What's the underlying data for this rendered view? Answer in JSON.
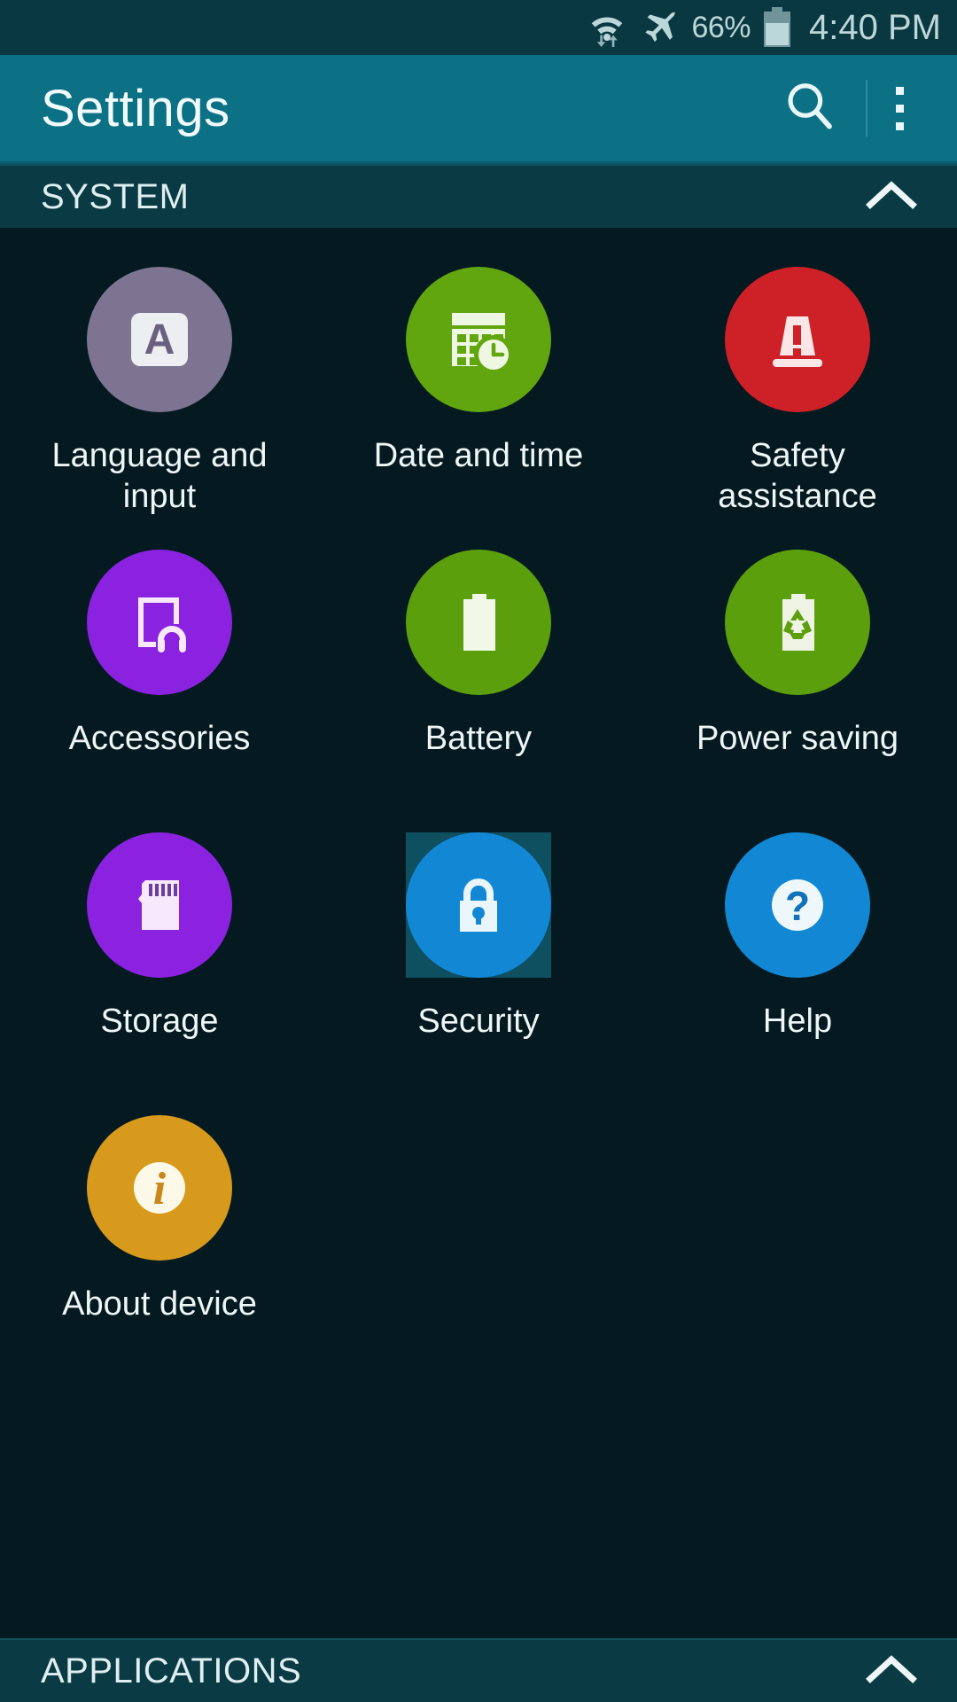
{
  "status_bar": {
    "wifi_icon": "wifi-data-transfer-icon",
    "airplane_icon": "airplane-mode-icon",
    "battery_percent": "66%",
    "battery_icon": "battery-icon",
    "time": "4:40 PM",
    "background_color": "#0a3840",
    "text_color": "#bcd7da"
  },
  "action_bar": {
    "title": "Settings",
    "search_icon": "search-icon",
    "overflow_icon": "more-vertical-icon",
    "background_color": "#0d7186"
  },
  "sections": {
    "system": {
      "title": "SYSTEM",
      "collapse_icon": "chevron-up-icon",
      "expanded": true
    },
    "applications": {
      "title": "APPLICATIONS",
      "collapse_icon": "chevron-up-icon"
    }
  },
  "grid_items": [
    {
      "label": "Language and\ninput",
      "icon": "language-input-icon",
      "circle_color": "#7d7491",
      "selected": false
    },
    {
      "label": "Date and time",
      "icon": "date-time-icon",
      "circle_color": "#61a60e",
      "selected": false
    },
    {
      "label": "Safety\nassistance",
      "icon": "safety-assistance-icon",
      "circle_color": "#ce2027",
      "selected": false
    },
    {
      "label": "Accessories",
      "icon": "accessories-icon",
      "circle_color": "#8a22e0",
      "selected": false
    },
    {
      "label": "Battery",
      "icon": "battery-settings-icon",
      "circle_color": "#5c9f0d",
      "selected": false
    },
    {
      "label": "Power saving",
      "icon": "power-saving-icon",
      "circle_color": "#5c9f0d",
      "selected": false
    },
    {
      "label": "Storage",
      "icon": "storage-sdcard-icon",
      "circle_color": "#8a22e0",
      "selected": false
    },
    {
      "label": "Security",
      "icon": "security-lock-icon",
      "circle_color": "#1288d4",
      "selected": true
    },
    {
      "label": "Help",
      "icon": "help-question-icon",
      "circle_color": "#1288d4",
      "selected": false
    },
    {
      "label": "About device",
      "icon": "about-device-info-icon",
      "circle_color": "#d79a1c",
      "selected": false
    }
  ],
  "theme": {
    "page_background": "#041a20",
    "section_background": "#0a3a44",
    "selection_color": "#0e4f60",
    "label_color": "#eef6f7"
  }
}
